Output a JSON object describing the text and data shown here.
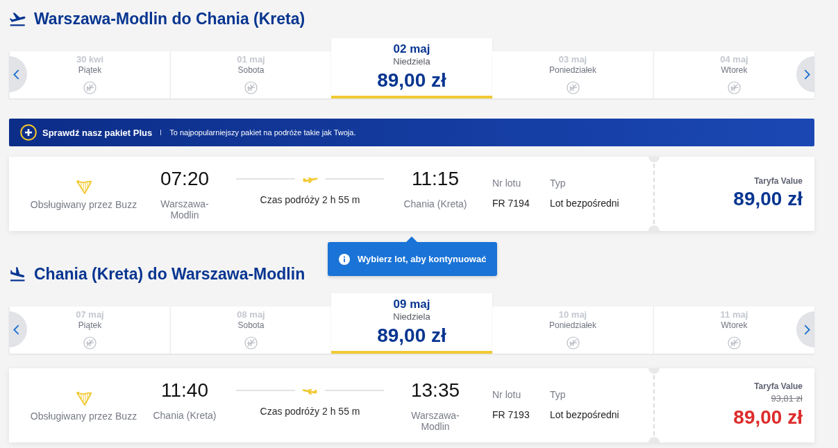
{
  "journeys": [
    {
      "kind": "outbound",
      "heading": "Warszawa-Modlin do Chania (Kreta)",
      "dates": [
        {
          "date": "30 kwi",
          "weekday": "Piątek",
          "no_flights": true,
          "selected": false
        },
        {
          "date": "01 maj",
          "weekday": "Sobota",
          "no_flights": true,
          "selected": false
        },
        {
          "date": "02 maj",
          "weekday": "Niedziela",
          "price": "89,00 zł",
          "no_flights": false,
          "selected": true
        },
        {
          "date": "03 maj",
          "weekday": "Poniedziałek",
          "no_flights": true,
          "selected": false
        },
        {
          "date": "04 maj",
          "weekday": "Wtorek",
          "no_flights": true,
          "selected": false
        }
      ],
      "promo_banner": {
        "title": "Sprawdź nasz pakiet Plus",
        "text": "To najpopularniejszy pakiet na podróże takie jak Twoja."
      },
      "flight": {
        "operator": "Obsługiwany przez Buzz",
        "departure": {
          "time": "07:20",
          "airport": "Warszawa-Modlin"
        },
        "duration": "Czas podróży 2 h 55 m",
        "arrival": {
          "time": "11:15",
          "airport": "Chania (Kreta)"
        },
        "flight_number": {
          "label": "Nr lotu",
          "value": "FR 7194"
        },
        "flight_type": {
          "label": "Typ",
          "value": "Lot bezpośredni"
        },
        "fare": {
          "name": "Taryfa Value",
          "price": "89,00 zł",
          "discounted": false
        }
      },
      "notice": "Wybierz lot, aby kontynuować"
    },
    {
      "kind": "inbound",
      "heading": "Chania (Kreta) do Warszawa-Modlin",
      "dates": [
        {
          "date": "07 maj",
          "weekday": "Piątek",
          "no_flights": true,
          "selected": false
        },
        {
          "date": "08 maj",
          "weekday": "Sobota",
          "no_flights": true,
          "selected": false
        },
        {
          "date": "09 maj",
          "weekday": "Niedziela",
          "price": "89,00 zł",
          "no_flights": false,
          "selected": true
        },
        {
          "date": "10 maj",
          "weekday": "Poniedziałek",
          "no_flights": true,
          "selected": false
        },
        {
          "date": "11 maj",
          "weekday": "Wtorek",
          "no_flights": true,
          "selected": false
        }
      ],
      "flight": {
        "operator": "Obsługiwany przez Buzz",
        "departure": {
          "time": "11:40",
          "airport": "Chania (Kreta)"
        },
        "duration": "Czas podróży 2 h 55 m",
        "arrival": {
          "time": "13:35",
          "airport": "Warszawa-Modlin"
        },
        "flight_number": {
          "label": "Nr lotu",
          "value": "FR 7193"
        },
        "flight_type": {
          "label": "Typ",
          "value": "Lot bezpośredni"
        },
        "fare": {
          "name": "Taryfa Value",
          "old_price": "93,81 zł",
          "price": "89,00 zł",
          "discounted": true
        }
      }
    }
  ]
}
